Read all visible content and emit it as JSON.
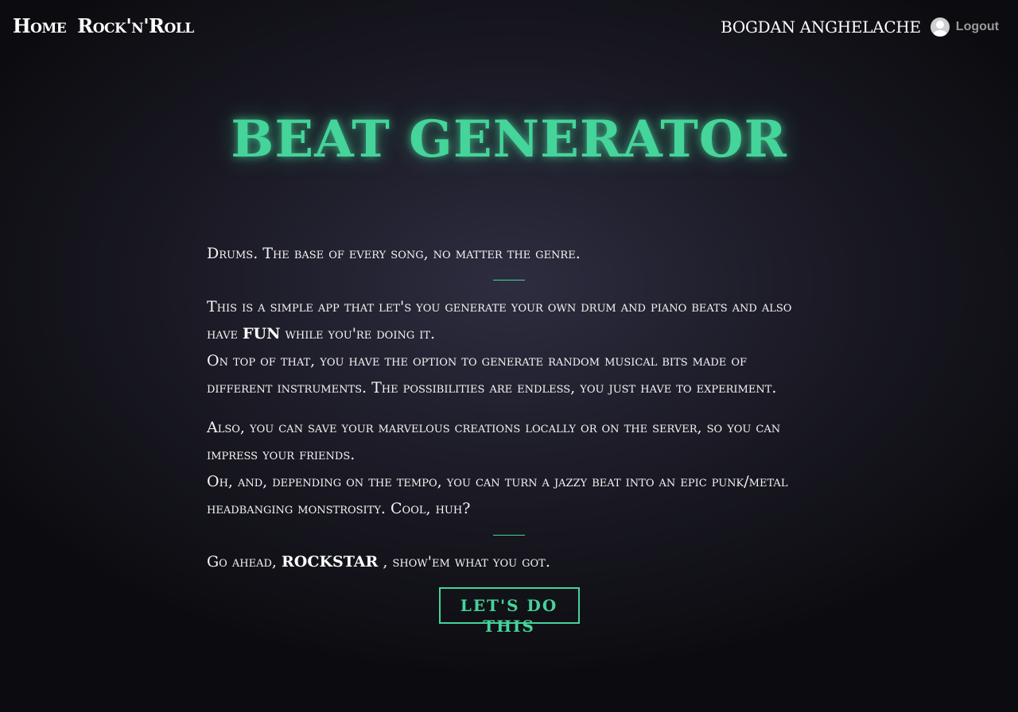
{
  "nav": {
    "home": "Home",
    "rocknroll": "Rock'n'Roll",
    "username": "BOGDAN ANGHELACHE",
    "logout": "Logout"
  },
  "title": "BEAT GENERATOR",
  "content": {
    "intro": "Drums. The base of every song, no matter the genre.",
    "p1_part1": "This is a simple app that let's you generate your own drum and piano beats and also have",
    "p1_fun": "FUN",
    "p1_part2": "while you're doing it.",
    "p2": "On top of that, you have the option to generate random musical bits made of different instruments. The possibilities are endless, you just have to experiment.",
    "p3": "Also, you can save your marvelous creations locally or on the server, so you can impress your friends.",
    "p4": "Oh, and, depending on the tempo, you can turn a jazzy beat into an epic punk/metal headbanging monstrosity. Cool, huh?",
    "outro_part1": "Go ahead,",
    "outro_rockstar": "ROCKSTAR",
    "outro_part2": ", show'em what you got."
  },
  "cta": {
    "label": "LET'S DO THIS"
  },
  "colors": {
    "accent": "#45d49a",
    "background": "#1d1c28",
    "logout": "#9a9a9a"
  },
  "icons": {
    "avatar": "user-avatar-icon"
  }
}
